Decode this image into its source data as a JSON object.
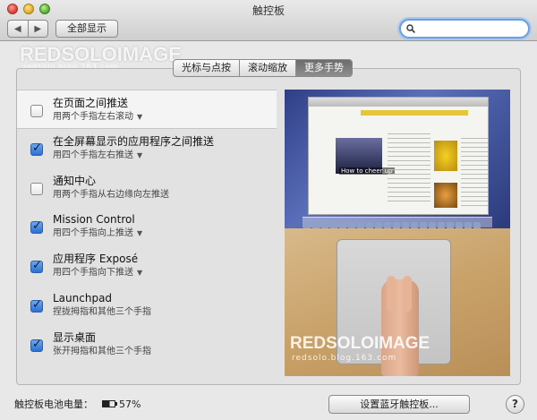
{
  "window": {
    "title": "触控板"
  },
  "toolbar": {
    "back_label": "◀",
    "forward_label": "▶",
    "show_all_label": "全部显示"
  },
  "search": {
    "value": "",
    "placeholder": ""
  },
  "watermark": {
    "main": "REDSOLOIMAGE",
    "sub": "redsolo.blog.163.com"
  },
  "tabs": [
    {
      "label": "光标与点按",
      "active": false
    },
    {
      "label": "滚动缩放",
      "active": false
    },
    {
      "label": "更多手势",
      "active": true
    }
  ],
  "gestures": [
    {
      "title": "在页面之间推送",
      "subtitle": "用两个手指左右滚动",
      "has_menu": true,
      "checked": false,
      "selected": true
    },
    {
      "title": "在全屏幕显示的应用程序之间推送",
      "subtitle": "用四个手指左右推送",
      "has_menu": true,
      "checked": true,
      "selected": false
    },
    {
      "title": "通知中心",
      "subtitle": "用两个手指从右边缘向左推送",
      "has_menu": false,
      "checked": false,
      "selected": false
    },
    {
      "title": "Mission Control",
      "subtitle": "用四个手指向上推送",
      "has_menu": true,
      "checked": true,
      "selected": false
    },
    {
      "title": "应用程序 Exposé",
      "subtitle": "用四个手指向下推送",
      "has_menu": true,
      "checked": true,
      "selected": false
    },
    {
      "title": "Launchpad",
      "subtitle": "捏拢拇指和其他三个手指",
      "has_menu": false,
      "checked": true,
      "selected": false
    },
    {
      "title": "显示桌面",
      "subtitle": "张开拇指和其他三个手指",
      "has_menu": false,
      "checked": true,
      "selected": false
    }
  ],
  "preview": {
    "photo_label": "How to cheer up",
    "watermark_main": "REDSOLOIMAGE",
    "watermark_sub": "redsolo.blog.163.com"
  },
  "footer": {
    "battery_label": "触控板电池电量：",
    "battery_percent": "57%",
    "battery_level": 0.57,
    "setup_button": "设置蓝牙触控板...",
    "help_label": "?"
  }
}
